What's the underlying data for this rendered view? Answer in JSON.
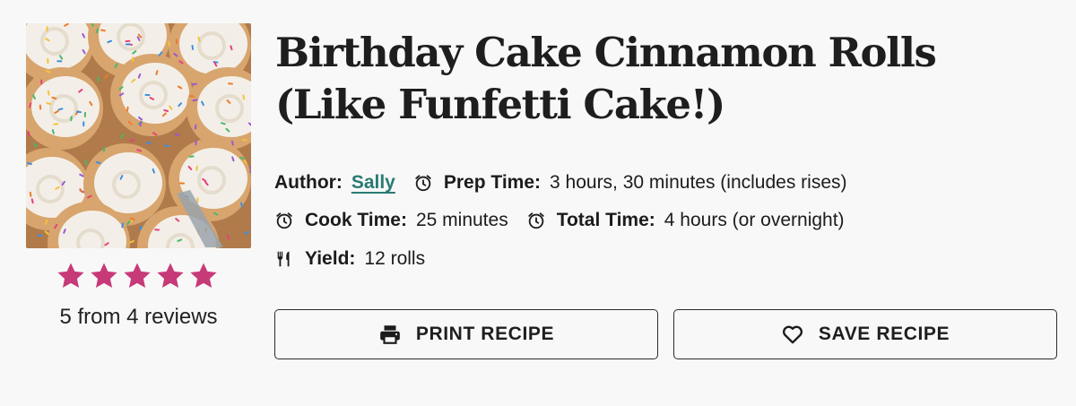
{
  "recipe": {
    "title": "Birthday Cake Cinnamon Rolls (Like Funfetti Cake!)",
    "photo_icon": "cinnamon-rolls-photo"
  },
  "rating": {
    "stars": 5,
    "max_stars": 5,
    "star_color": "#c73a78",
    "text": "5 from 4 reviews"
  },
  "meta": {
    "author_label": "Author:",
    "author_value": "Sally",
    "prep_label": "Prep Time:",
    "prep_value": "3 hours, 30 minutes (includes rises)",
    "cook_label": "Cook Time:",
    "cook_value": "25 minutes",
    "total_label": "Total Time:",
    "total_value": "4 hours (or overnight)",
    "yield_label": "Yield:",
    "yield_value": "12 rolls",
    "link_color": "#2a7b74"
  },
  "actions": {
    "print_label": "PRINT RECIPE",
    "print_icon": "printer-icon",
    "save_label": "SAVE RECIPE",
    "save_icon": "heart-icon"
  }
}
